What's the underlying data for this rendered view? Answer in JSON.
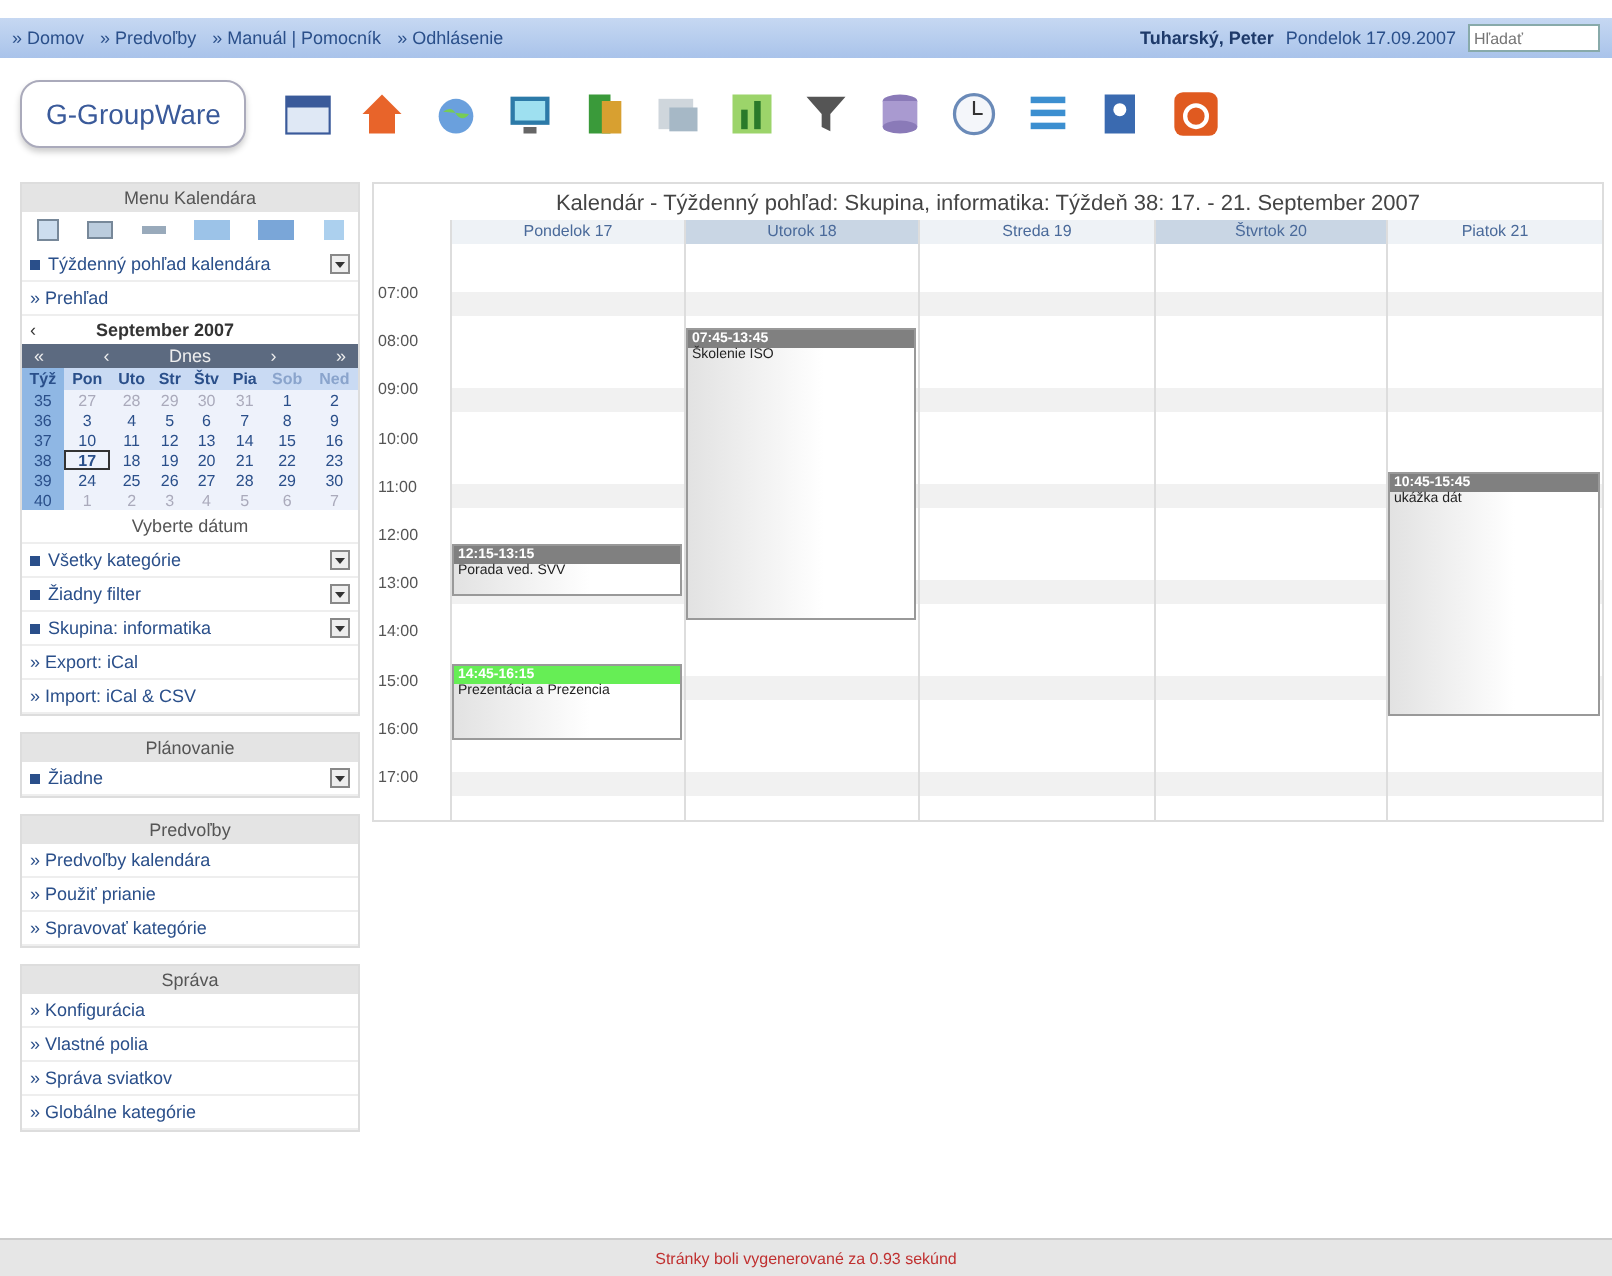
{
  "top_nav": {
    "links": [
      "» Domov",
      "» Predvoľby",
      "» Manuál | Pomocník",
      "» Odhlásenie"
    ],
    "user": "Tuharský, Peter",
    "date": "Pondelok 17.09.2007",
    "search": {
      "placeholder": "Hľadať"
    }
  },
  "logo": "G-GroupWare",
  "sidebar": {
    "title": "Menu Kalendára",
    "view_select": "Týždenný pohľad kalendára",
    "overview_link": "» Prehľad",
    "mini_calendar": {
      "prev_year": "‹",
      "month": "September 2007",
      "nav": [
        "«",
        "‹",
        "Dnes",
        "›",
        "»"
      ],
      "weekdays": [
        "Týž",
        "Pon",
        "Uto",
        "Str",
        "Štv",
        "Pia",
        "Sob",
        "Ned"
      ],
      "weeks": [
        {
          "week": "35",
          "days": [
            {
              "day": "27",
              "muted": true,
              "selected": false
            },
            {
              "day": "28",
              "muted": true,
              "selected": false
            },
            {
              "day": "29",
              "muted": true,
              "selected": false
            },
            {
              "day": "30",
              "muted": true,
              "selected": false
            },
            {
              "day": "31",
              "muted": true,
              "selected": false
            },
            {
              "day": "1",
              "muted": false,
              "selected": false
            },
            {
              "day": "2",
              "muted": false,
              "selected": false
            }
          ]
        },
        {
          "week": "36",
          "days": [
            {
              "day": "3",
              "muted": false,
              "selected": false
            },
            {
              "day": "4",
              "muted": false,
              "selected": false
            },
            {
              "day": "5",
              "muted": false,
              "selected": false
            },
            {
              "day": "6",
              "muted": false,
              "selected": false
            },
            {
              "day": "7",
              "muted": false,
              "selected": false
            },
            {
              "day": "8",
              "muted": false,
              "selected": false
            },
            {
              "day": "9",
              "muted": false,
              "selected": false
            }
          ]
        },
        {
          "week": "37",
          "days": [
            {
              "day": "10",
              "muted": false,
              "selected": false
            },
            {
              "day": "11",
              "muted": false,
              "selected": false
            },
            {
              "day": "12",
              "muted": false,
              "selected": false
            },
            {
              "day": "13",
              "muted": false,
              "selected": false
            },
            {
              "day": "14",
              "muted": false,
              "selected": false
            },
            {
              "day": "15",
              "muted": false,
              "selected": false
            },
            {
              "day": "16",
              "muted": false,
              "selected": false
            }
          ]
        },
        {
          "week": "38",
          "days": [
            {
              "day": "17",
              "muted": false,
              "selected": true
            },
            {
              "day": "18",
              "muted": false,
              "selected": false
            },
            {
              "day": "19",
              "muted": false,
              "selected": false
            },
            {
              "day": "20",
              "muted": false,
              "selected": false
            },
            {
              "day": "21",
              "muted": false,
              "selected": false
            },
            {
              "day": "22",
              "muted": false,
              "selected": false
            },
            {
              "day": "23",
              "muted": false,
              "selected": false
            }
          ]
        },
        {
          "week": "39",
          "days": [
            {
              "day": "24",
              "muted": false,
              "selected": false
            },
            {
              "day": "25",
              "muted": false,
              "selected": false
            },
            {
              "day": "26",
              "muted": false,
              "selected": false
            },
            {
              "day": "27",
              "muted": false,
              "selected": false
            },
            {
              "day": "28",
              "muted": false,
              "selected": false
            },
            {
              "day": "29",
              "muted": false,
              "selected": false
            },
            {
              "day": "30",
              "muted": false,
              "selected": false
            }
          ]
        },
        {
          "week": "40",
          "days": [
            {
              "day": "1",
              "muted": true,
              "selected": false
            },
            {
              "day": "2",
              "muted": true,
              "selected": false
            },
            {
              "day": "3",
              "muted": true,
              "selected": false
            },
            {
              "day": "4",
              "muted": true,
              "selected": false
            },
            {
              "day": "5",
              "muted": true,
              "selected": false
            },
            {
              "day": "6",
              "muted": true,
              "selected": false
            },
            {
              "day": "7",
              "muted": true,
              "selected": false
            }
          ]
        }
      ],
      "footer": "Vyberte dátum"
    },
    "filters": [
      {
        "kind": "select",
        "label": "Všetky kategórie"
      },
      {
        "kind": "select",
        "label": "Žiadny filter"
      },
      {
        "kind": "select",
        "label": "Skupina: informatika"
      },
      {
        "kind": "link",
        "label": "» Export: iCal"
      },
      {
        "kind": "link",
        "label": "» Import: iCal & CSV"
      }
    ],
    "sections": [
      {
        "title": "Plánovanie",
        "items": [
          {
            "kind": "select",
            "label": "Žiadne"
          }
        ]
      },
      {
        "title": "Predvoľby",
        "items": [
          {
            "kind": "link",
            "label": "» Predvoľby kalendára"
          },
          {
            "kind": "link",
            "label": "» Použiť prianie"
          },
          {
            "kind": "link",
            "label": "» Spravovať kategórie"
          }
        ]
      },
      {
        "title": "Správa",
        "items": [
          {
            "kind": "link",
            "label": "» Konfigurácia"
          },
          {
            "kind": "link",
            "label": "» Vlastné polia"
          },
          {
            "kind": "link",
            "label": "» Správa sviatkov"
          },
          {
            "kind": "link",
            "label": "» Globálne kategórie"
          }
        ]
      }
    ]
  },
  "calendar": {
    "title": "Kalendár - Týždenný pohľad: Skupina, informatika: Týždeň 38: 17. - 21. September 2007",
    "times": [
      "07:00",
      "08:00",
      "09:00",
      "10:00",
      "11:00",
      "12:00",
      "13:00",
      "14:00",
      "15:00",
      "16:00",
      "17:00"
    ],
    "days": [
      {
        "label": "Pondelok 17",
        "events": [
          {
            "time": "12:15-13:15",
            "title": "Porada ved. SVV",
            "color": "#808080"
          },
          {
            "time": "14:45-16:15",
            "title": "Prezentácia a Prezencia",
            "color": "#66ee55"
          }
        ]
      },
      {
        "label": "Utorok 18",
        "events": [
          {
            "time": "07:45-13:45",
            "title": "Školenie ISO",
            "color": "#808080"
          }
        ]
      },
      {
        "label": "Streda 19"
      },
      {
        "label": "Štvrtok 20"
      },
      {
        "label": "Piatok 21",
        "events": [
          {
            "time": "10:45-15:45",
            "title": "ukážka dát",
            "color": "#808080"
          }
        ]
      }
    ]
  },
  "status": "Stránky boli vygenerované za 0.93 sekúnd"
}
